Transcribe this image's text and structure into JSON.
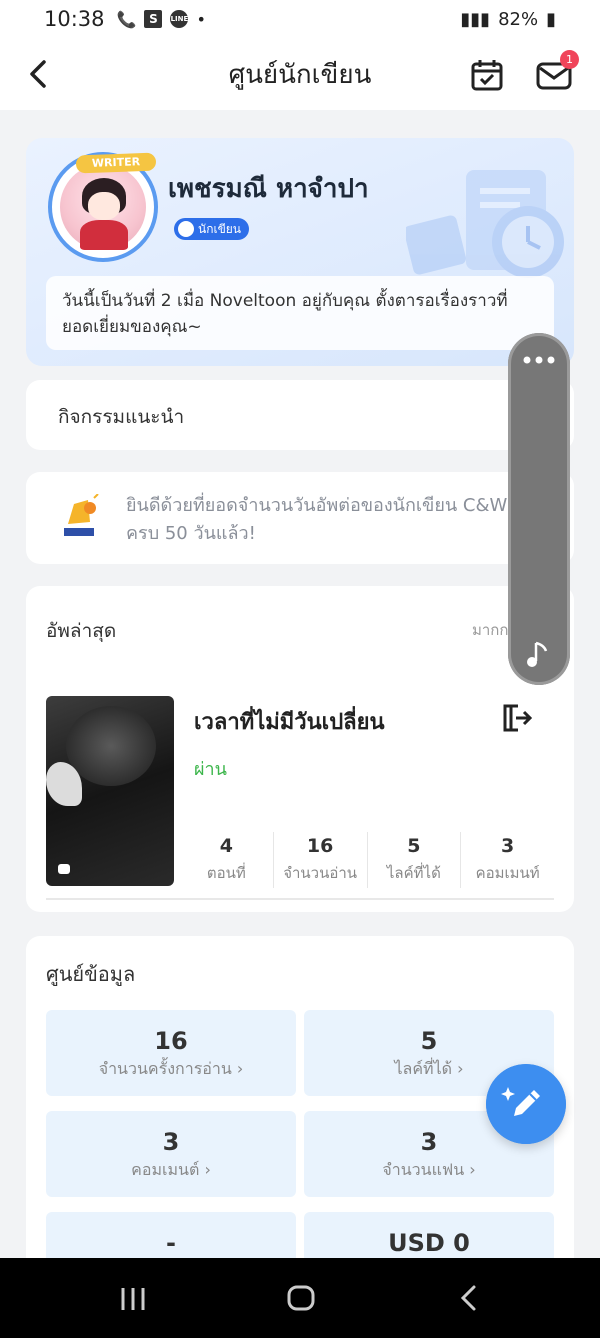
{
  "status_bar": {
    "time": "10:38",
    "battery": "82%",
    "icons_left": [
      "S",
      "LINE"
    ]
  },
  "header": {
    "title": "ศูนย์นักเขียน",
    "mail_badge": "1"
  },
  "profile": {
    "writer_tag": "WRITER",
    "name": "เพชรมณี หาจำปา",
    "role": "นักเขียน",
    "message": "วันนี้เป็นวันที่ 2 เมื่อ Noveltoon อยู่กับคุณ ตั้งตารอเรื่องราวที่ยอดเยี่ยมของคุณ~"
  },
  "activity": {
    "label": "กิจกรรมแนะนำ"
  },
  "notice": {
    "text": "ยินดีด้วยที่ยอดจำนวนวันอัพต่อของนักเขียน C&W ครบ 50 วันแล้ว!"
  },
  "latest": {
    "title": "อัพล่าสุด",
    "more": "มากก",
    "book": {
      "title": "เวลาที่ไม่มีวันเปลี่ยน",
      "status": "ผ่าน",
      "stats": [
        {
          "value": "4",
          "label": "ตอนที่"
        },
        {
          "value": "16",
          "label": "จำนวนอ่าน"
        },
        {
          "value": "5",
          "label": "ไลค์ที่ได้"
        },
        {
          "value": "3",
          "label": "คอมเมนท์"
        }
      ]
    }
  },
  "data_center": {
    "title": "ศูนย์ข้อมูล",
    "tiles": [
      {
        "value": "16",
        "label": "จำนวนครั้งการอ่าน ›"
      },
      {
        "value": "5",
        "label": "ไลค์ที่ได้ ›"
      },
      {
        "value": "3",
        "label": "คอมเมนต์ ›"
      },
      {
        "value": "3",
        "label": "จำนวนแฟน ›"
      },
      {
        "value": "-",
        "label": ""
      },
      {
        "value": "USD 0",
        "label": ""
      }
    ]
  },
  "colors": {
    "accent": "#2d6ee9",
    "pass": "#3bb54a",
    "badge": "#f0445a",
    "fab": "#3d8ef0"
  }
}
